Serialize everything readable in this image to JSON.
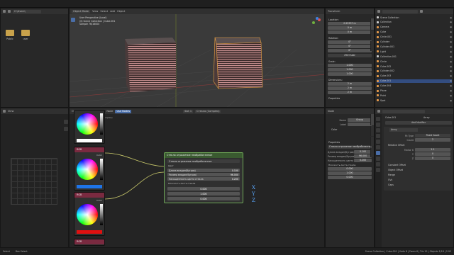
{
  "topbar": {
    "viewport_mode": "Object Mode",
    "view": "View",
    "select": "Select",
    "add": "Add",
    "object": "Object"
  },
  "file_browser": {
    "path": "C:\\Users\\",
    "items": [
      {
        "label": "Public"
      },
      {
        "label": "user"
      }
    ]
  },
  "viewport": {
    "info_line1": "User Perspective (Local)",
    "info_line2": "(0) Scene Collection | Cube.001",
    "info_line3": "Sample 76/16000"
  },
  "n_panel": {
    "header": "Transform",
    "section_location": "Location:",
    "location": [
      "0.25537 m",
      "0 m",
      "0 m"
    ],
    "section_rotation": "Rotation:",
    "rotation": [
      "0°",
      "0°",
      "0°"
    ],
    "rotation_mode": "XYZ Euler",
    "section_scale": "Scale:",
    "scale": [
      "1.000",
      "1.000",
      "1.000"
    ],
    "section_dimensions": "Dimensions:",
    "dimensions": [
      "2 m",
      "2 m",
      "2 m"
    ],
    "properties": "Properties",
    "tabs": [
      "Item",
      "Tool",
      "View"
    ]
  },
  "outliner": {
    "header": "Scene Collection",
    "rows": [
      {
        "label": "Scene Collection",
        "color": "#d0d0d0"
      },
      {
        "label": "Collection",
        "color": "#d0d0d0"
      },
      {
        "label": "Camera",
        "color": "#e89b4a"
      },
      {
        "label": "Cube",
        "color": "#e89b4a"
      },
      {
        "label": "Circle.001",
        "color": "#e89b4a"
      },
      {
        "label": "Cylinder",
        "color": "#e89b4a"
      },
      {
        "label": "Cylinder.001",
        "color": "#e89b4a"
      },
      {
        "label": "Light",
        "color": "#e89b4a"
      },
      {
        "label": "Collection.001",
        "color": "#d0d0d0"
      },
      {
        "label": "Circle",
        "color": "#e89b4a"
      },
      {
        "label": "Cube.002",
        "color": "#e89b4a"
      },
      {
        "label": "Cylinder.002",
        "color": "#e89b4a"
      },
      {
        "label": "Cube.003",
        "color": "#e89b4a"
      },
      {
        "label": "Cube.001",
        "color": "#e89b4a"
      },
      {
        "label": "Cube.004",
        "color": "#e89b4a"
      },
      {
        "label": "Plane",
        "color": "#e89b4a"
      },
      {
        "label": "Point",
        "color": "#e89b4a"
      },
      {
        "label": "Spot",
        "color": "#e89b4a"
      }
    ],
    "selected_index": 13
  },
  "properties_editor": {
    "object_name": "Cube.001",
    "modifier": "Array",
    "add_modifier": "Add Modifier",
    "fit_type_label": "Fit Type",
    "fit_type": "Fixed Count",
    "count_label": "Count",
    "count": "2",
    "relative_offset": "Relative Offset",
    "factor_x_label": "Factor X",
    "factor_x": "1.1",
    "y_label": "Y",
    "y": "0",
    "z_label": "Z",
    "z": "0",
    "constant_offset": "Constant Offset",
    "object_offset": "Object Offset",
    "merge": "Merge",
    "uvs": "UVs",
    "caps": "Caps"
  },
  "node_editor": {
    "header_items": [
      "Object",
      "View",
      "Select",
      "Add",
      "Node"
    ],
    "use_nodes": "Use Nodes",
    "slot": "Slot 1",
    "material": "Стекло (Complex)",
    "breadcrumb": "Cube.001 > Стекло (Complex)",
    "rgb_nodes": [
      {
        "title": "RGB",
        "output": "Color",
        "swatch": "#ffffff"
      },
      {
        "title": "RGB",
        "output": "Color",
        "swatch": "#1e74e8"
      },
      {
        "title": "RGB",
        "output": "Color",
        "swatch": "#e01010"
      },
      {
        "title": "RGB"
      }
    ],
    "group_node": {
      "title": "Стекло отражение необработанное",
      "dropdown": "Стекло отражение необработанное",
      "section": "Цвет",
      "inputs": [
        {
          "label": "Длина впадин(бугров)",
          "value": "0.100"
        },
        {
          "label": "Размер впадин(бугров)",
          "value": "96.000"
        },
        {
          "label": "Насыщенность цвета стекла",
          "value": "0.200"
        }
      ],
      "vector_label": "Плоскость листа стекла",
      "vector": [
        "0.000",
        "1.000",
        "0.000"
      ]
    },
    "annotations": [
      "X",
      "Y",
      "Z"
    ]
  },
  "node_sidebar": {
    "title": "Node",
    "name_label": "Name",
    "name_value": "Group",
    "label_label": "Label",
    "label_value": "",
    "color": "Color",
    "properties": "Properties",
    "group_dropdown": "Стекло отражение необработанное",
    "rows": [
      {
        "label": "Длина впадин(бугров)",
        "value": "0.100"
      },
      {
        "label": "Размер впадин(бугров)",
        "value": "96.000"
      },
      {
        "label": "Насыщенность цвета стекла",
        "value": "0.200"
      }
    ],
    "vector_label": "Плоскость листа стекла",
    "vector": [
      "0.000",
      "1.000",
      "0.000"
    ],
    "tabs": [
      "Node",
      "Tool",
      "View",
      "Options"
    ]
  },
  "statusbar": {
    "left": "Select",
    "mid": "Box Select",
    "right": "Scene Collection | Cube.001 | Verts 8 | Faces 6 | Tris 12 | Objects 1/18 | 2.93"
  }
}
